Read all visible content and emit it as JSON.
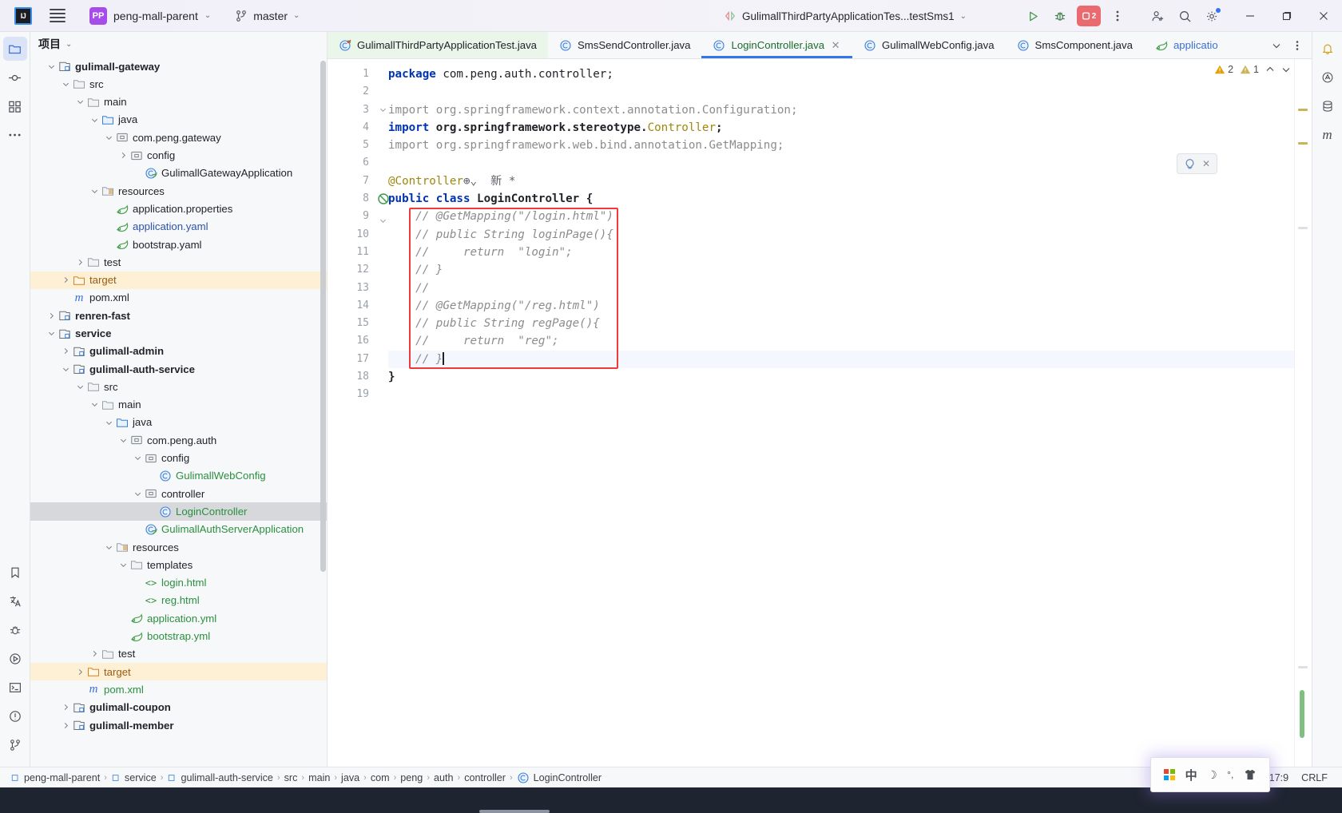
{
  "titlebar": {
    "logo": "IJ",
    "menu_icon": "hamburger-icon",
    "project_badge": "PP",
    "project_name": "peng-mall-parent",
    "branch_icon": "git-branch-icon",
    "branch_name": "master",
    "run_config_name": "GulimallThirdPartyApplicationTes...testSms1",
    "run_icon": "run-icon",
    "debug_icon": "debug-icon",
    "stop_label": "2",
    "more_icon": "more-vertical-icon",
    "add_user_icon": "add-user-icon",
    "search_icon": "search-icon",
    "settings_icon": "gear-icon",
    "minimize": "minimize-icon",
    "maximize": "maximize-icon",
    "close": "close-icon"
  },
  "left_rail": [
    {
      "name": "project-tool-window",
      "icon": "folder-icon",
      "active": true
    },
    {
      "name": "commit-tool-window",
      "icon": "commit-icon"
    },
    {
      "name": "structure-tool-window",
      "icon": "structure-icon"
    },
    {
      "name": "more-tool-windows",
      "icon": "ellipsis-icon"
    }
  ],
  "left_rail_bottom": [
    {
      "name": "bookmarks-tool-window",
      "icon": "bookmark-icon"
    },
    {
      "name": "translation-tool-window",
      "icon": "translate-icon"
    },
    {
      "name": "debugger-tool-window",
      "icon": "bug-icon"
    },
    {
      "name": "run-tool-window",
      "icon": "play-icon"
    },
    {
      "name": "terminal-tool-window",
      "icon": "terminal-icon"
    },
    {
      "name": "problems-tool-window",
      "icon": "warning-icon"
    },
    {
      "name": "version-control-tool-window",
      "icon": "git-icon"
    }
  ],
  "right_rail": [
    {
      "name": "notifications-tool-window",
      "icon": "bell-icon"
    },
    {
      "name": "ai-assistant-tool-window",
      "icon": "ai-icon"
    },
    {
      "name": "database-tool-window",
      "icon": "database-icon"
    },
    {
      "name": "maven-tool-window",
      "icon": "maven-m-icon"
    }
  ],
  "project_panel": {
    "title": "项目",
    "title_chevron": "chevron-down-icon",
    "tree": [
      {
        "depth": 2,
        "arrow": "down",
        "icon": "module-icon",
        "label": "gulimall-gateway",
        "style": "bold"
      },
      {
        "depth": 3,
        "arrow": "down",
        "icon": "folder-icon",
        "label": "src",
        "style": ""
      },
      {
        "depth": 4,
        "arrow": "down",
        "icon": "folder-icon",
        "label": "main",
        "style": ""
      },
      {
        "depth": 5,
        "arrow": "down",
        "icon": "source-folder-icon",
        "label": "java",
        "style": ""
      },
      {
        "depth": 6,
        "arrow": "down",
        "icon": "package-icon",
        "label": "com.peng.gateway",
        "style": ""
      },
      {
        "depth": 7,
        "arrow": "right",
        "icon": "package-icon",
        "label": "config",
        "style": ""
      },
      {
        "depth": 8,
        "arrow": "none",
        "icon": "spring-class-icon",
        "label": "GulimallGatewayApplication",
        "style": ""
      },
      {
        "depth": 5,
        "arrow": "down",
        "icon": "resource-folder-icon",
        "label": "resources",
        "style": ""
      },
      {
        "depth": 6,
        "arrow": "none",
        "icon": "spring-file-icon",
        "label": "application.properties",
        "style": ""
      },
      {
        "depth": 6,
        "arrow": "none",
        "icon": "spring-file-icon",
        "label": "application.yaml",
        "style": "blue"
      },
      {
        "depth": 6,
        "arrow": "none",
        "icon": "spring-file-icon",
        "label": "bootstrap.yaml",
        "style": ""
      },
      {
        "depth": 4,
        "arrow": "right",
        "icon": "folder-icon",
        "label": "test",
        "style": ""
      },
      {
        "depth": 3,
        "arrow": "right",
        "icon": "excluded-folder-icon",
        "label": "target",
        "style": "excluded"
      },
      {
        "depth": 3,
        "arrow": "none",
        "icon": "maven-m-icon",
        "label": "pom.xml",
        "style": ""
      },
      {
        "depth": 2,
        "arrow": "right",
        "icon": "module-icon",
        "label": "renren-fast",
        "style": "bold"
      },
      {
        "depth": 2,
        "arrow": "down",
        "icon": "module-icon",
        "label": "service",
        "style": "bold"
      },
      {
        "depth": 3,
        "arrow": "right",
        "icon": "module-icon",
        "label": "gulimall-admin",
        "style": "bold"
      },
      {
        "depth": 3,
        "arrow": "down",
        "icon": "module-icon",
        "label": "gulimall-auth-service",
        "style": "bold"
      },
      {
        "depth": 4,
        "arrow": "down",
        "icon": "folder-icon",
        "label": "src",
        "style": ""
      },
      {
        "depth": 5,
        "arrow": "down",
        "icon": "folder-icon",
        "label": "main",
        "style": ""
      },
      {
        "depth": 6,
        "arrow": "down",
        "icon": "source-folder-icon",
        "label": "java",
        "style": ""
      },
      {
        "depth": 7,
        "arrow": "down",
        "icon": "package-icon",
        "label": "com.peng.auth",
        "style": ""
      },
      {
        "depth": 8,
        "arrow": "down",
        "icon": "package-icon",
        "label": "config",
        "style": ""
      },
      {
        "depth": 9,
        "arrow": "none",
        "icon": "class-icon",
        "label": "GulimallWebConfig",
        "style": "green"
      },
      {
        "depth": 8,
        "arrow": "down",
        "icon": "package-icon",
        "label": "controller",
        "style": ""
      },
      {
        "depth": 9,
        "arrow": "none",
        "icon": "class-icon",
        "label": "LoginController",
        "style": "green selected"
      },
      {
        "depth": 8,
        "arrow": "none",
        "icon": "spring-class-icon",
        "label": "GulimallAuthServerApplication",
        "style": "green"
      },
      {
        "depth": 6,
        "arrow": "down",
        "icon": "resource-folder-icon",
        "label": "resources",
        "style": ""
      },
      {
        "depth": 7,
        "arrow": "down",
        "icon": "folder-icon",
        "label": "templates",
        "style": ""
      },
      {
        "depth": 8,
        "arrow": "none",
        "icon": "html-icon",
        "label": "login.html",
        "style": "green"
      },
      {
        "depth": 8,
        "arrow": "none",
        "icon": "html-icon",
        "label": "reg.html",
        "style": "green"
      },
      {
        "depth": 7,
        "arrow": "none",
        "icon": "spring-file-icon",
        "label": "application.yml",
        "style": "green"
      },
      {
        "depth": 7,
        "arrow": "none",
        "icon": "spring-file-icon",
        "label": "bootstrap.yml",
        "style": "green"
      },
      {
        "depth": 5,
        "arrow": "right",
        "icon": "folder-icon",
        "label": "test",
        "style": ""
      },
      {
        "depth": 4,
        "arrow": "right",
        "icon": "excluded-folder-icon",
        "label": "target",
        "style": "excluded"
      },
      {
        "depth": 4,
        "arrow": "none",
        "icon": "maven-m-icon",
        "label": "pom.xml",
        "style": "green"
      },
      {
        "depth": 3,
        "arrow": "right",
        "icon": "module-icon",
        "label": "gulimall-coupon",
        "style": "bold"
      },
      {
        "depth": 3,
        "arrow": "right",
        "icon": "module-icon",
        "label": "gulimall-member",
        "style": "bold"
      }
    ]
  },
  "editor_tabs": [
    {
      "label": "GulimallThirdPartyApplicationTest.java",
      "icon": "test-class-icon",
      "state": "test"
    },
    {
      "label": "SmsSendController.java",
      "icon": "class-icon",
      "state": ""
    },
    {
      "label": "LoginController.java",
      "icon": "class-icon",
      "state": "active",
      "close": "close-icon"
    },
    {
      "label": "GulimallWebConfig.java",
      "icon": "class-icon",
      "state": ""
    },
    {
      "label": "SmsComponent.java",
      "icon": "class-icon",
      "state": ""
    },
    {
      "label": "applicatio",
      "icon": "spring-file-icon",
      "state": "truncated"
    }
  ],
  "tabstrip_actions": [
    {
      "name": "tab-list-button",
      "icon": "chevron-down-icon"
    },
    {
      "name": "tab-options-button",
      "icon": "more-vertical-icon"
    }
  ],
  "inspections": {
    "warning_icon": "warning-triangle-icon",
    "warning_count": "2",
    "weak_warning_icon": "weak-warning-icon",
    "weak_warning_count": "1",
    "prev_icon": "chevron-up-icon",
    "next_icon": "chevron-down-icon",
    "hint_icon": "intention-bulb-icon",
    "hint_close_icon": "close-icon"
  },
  "code": {
    "lines": [
      {
        "n": "1",
        "tokens": [
          {
            "t": "package ",
            "c": "kw"
          },
          {
            "t": "com.peng.auth.controller;",
            "c": "pkgpath"
          }
        ]
      },
      {
        "n": "2",
        "tokens": []
      },
      {
        "n": "3",
        "fold": "down",
        "tokens": [
          {
            "t": "import org.springframework.context.annotation.Configuration;",
            "c": "gray"
          }
        ]
      },
      {
        "n": "4",
        "tokens": [
          {
            "t": "import ",
            "c": "kw"
          },
          {
            "t": "org.springframework.stereotype.",
            "c": "cls"
          },
          {
            "t": "Controller",
            "c": "ann"
          },
          {
            "t": ";",
            "c": "cls"
          }
        ]
      },
      {
        "n": "5",
        "tokens": [
          {
            "t": "import org.springframework.web.bind.annotation.GetMapping;",
            "c": "gray"
          }
        ]
      },
      {
        "n": "6",
        "tokens": []
      },
      {
        "n": "7",
        "tokens": [
          {
            "t": "@Controller",
            "c": "ann"
          }
        ],
        "suffix_globe": true,
        "suffix_text": "新 *"
      },
      {
        "n": "8",
        "gutter_icon": "not-interested-icon",
        "tokens": [
          {
            "t": "public ",
            "c": "kw"
          },
          {
            "t": "class ",
            "c": "kw"
          },
          {
            "t": "LoginController ",
            "c": "cls"
          },
          {
            "t": "{",
            "c": "cls"
          }
        ]
      },
      {
        "n": "9",
        "fold": "down",
        "indent": 1,
        "tokens": [
          {
            "t": "// @GetMapping(\"/login.html\")",
            "c": "cmt"
          }
        ]
      },
      {
        "n": "10",
        "indent": 1,
        "tokens": [
          {
            "t": "// public String loginPage(){",
            "c": "cmt"
          }
        ]
      },
      {
        "n": "11",
        "indent": 1,
        "tokens": [
          {
            "t": "//     return  \"login\";",
            "c": "cmt"
          }
        ]
      },
      {
        "n": "12",
        "indent": 1,
        "tokens": [
          {
            "t": "// }",
            "c": "cmt"
          }
        ]
      },
      {
        "n": "13",
        "indent": 1,
        "tokens": [
          {
            "t": "//",
            "c": "cmt"
          }
        ]
      },
      {
        "n": "14",
        "indent": 1,
        "tokens": [
          {
            "t": "// @GetMapping(\"/reg.html\")",
            "c": "cmt"
          }
        ]
      },
      {
        "n": "15",
        "indent": 1,
        "tokens": [
          {
            "t": "// public String regPage(){",
            "c": "cmt"
          }
        ]
      },
      {
        "n": "16",
        "indent": 1,
        "tokens": [
          {
            "t": "//     return  \"reg\";",
            "c": "cmt"
          }
        ]
      },
      {
        "n": "17",
        "indent": 1,
        "current": true,
        "caret": true,
        "tokens": [
          {
            "t": "// }",
            "c": "cmt"
          }
        ]
      },
      {
        "n": "18",
        "tokens": [
          {
            "t": "}",
            "c": "cls"
          }
        ]
      },
      {
        "n": "19",
        "tokens": []
      }
    ]
  },
  "breadcrumb": {
    "items": [
      {
        "label": "peng-mall-parent",
        "icon": "module-small-icon"
      },
      {
        "label": "service",
        "icon": "module-small-icon"
      },
      {
        "label": "gulimall-auth-service",
        "icon": "module-small-icon"
      },
      {
        "label": "src",
        "icon": ""
      },
      {
        "label": "main",
        "icon": ""
      },
      {
        "label": "java",
        "icon": ""
      },
      {
        "label": "com",
        "icon": ""
      },
      {
        "label": "peng",
        "icon": ""
      },
      {
        "label": "auth",
        "icon": ""
      },
      {
        "label": "controller",
        "icon": ""
      },
      {
        "label": "LoginController",
        "icon": "class-icon"
      }
    ],
    "separator": "›",
    "caret_position": "17:9",
    "line_separator": "CRLF"
  },
  "tray": {
    "items": [
      {
        "name": "windows-start-icon",
        "glyph": "windows"
      },
      {
        "name": "ime-chinese-icon",
        "glyph": "中"
      },
      {
        "name": "ime-halfwidth-icon",
        "glyph": "☽"
      },
      {
        "name": "ime-punctuation-icon",
        "glyph": "°,"
      },
      {
        "name": "ime-skin-icon",
        "glyph": "shirt"
      }
    ]
  },
  "colors": {
    "accent": "#3574f0",
    "added_vcs": "#2a8f3f",
    "modified_vcs": "#2c53a8",
    "excluded_bg": "#fdf0d4",
    "annotation_box": "#f03a3a",
    "stop_button": "#eb6a6f",
    "project_badge": "#a64ceb"
  }
}
